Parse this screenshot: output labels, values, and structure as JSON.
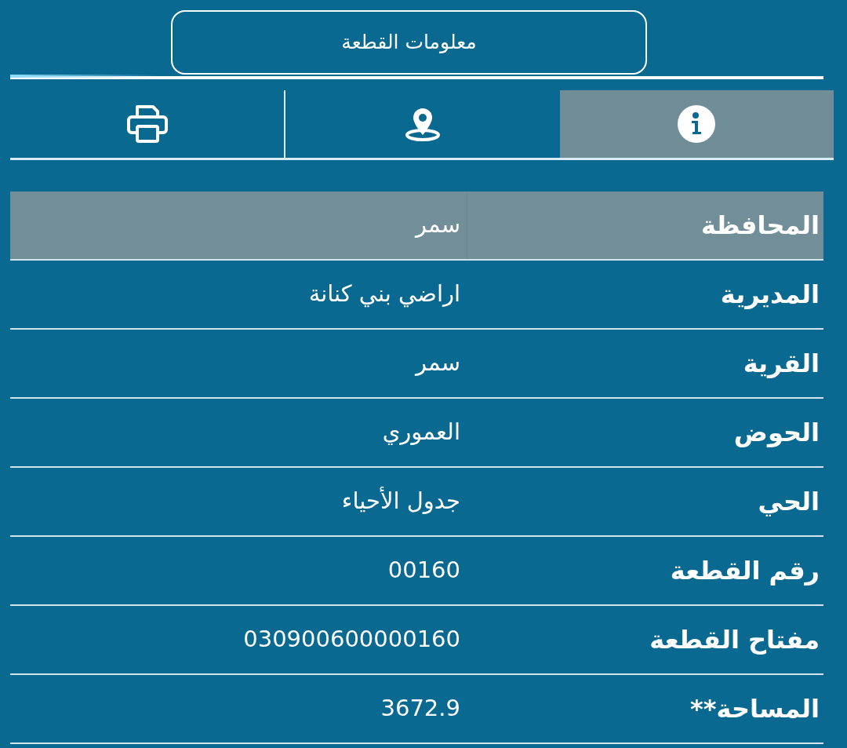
{
  "header": {
    "title": "معلومات القطعة"
  },
  "progress": {
    "level": 0.185
  },
  "tabs": [
    {
      "kind": "info",
      "selected": true
    },
    {
      "kind": "location",
      "selected": false
    },
    {
      "kind": "print",
      "selected": false
    }
  ],
  "rows": [
    {
      "label": "المحافظة",
      "value": "سمر",
      "highlighted": true
    },
    {
      "label": "المديرية",
      "value": "اراضي بني كنانة",
      "highlighted": false
    },
    {
      "label": "القرية",
      "value": "سمر",
      "highlighted": false
    },
    {
      "label": "الحوض",
      "value": "العموري",
      "highlighted": false
    },
    {
      "label": "الحي",
      "value": "جدول الأحياء",
      "highlighted": false
    },
    {
      "label": "رقم القطعة",
      "value": "00160",
      "highlighted": false
    },
    {
      "label": "مفتاح القطعة",
      "value": "030900600000160",
      "highlighted": false
    },
    {
      "label": "المساحة**",
      "value": "3672.9",
      "highlighted": false
    }
  ]
}
